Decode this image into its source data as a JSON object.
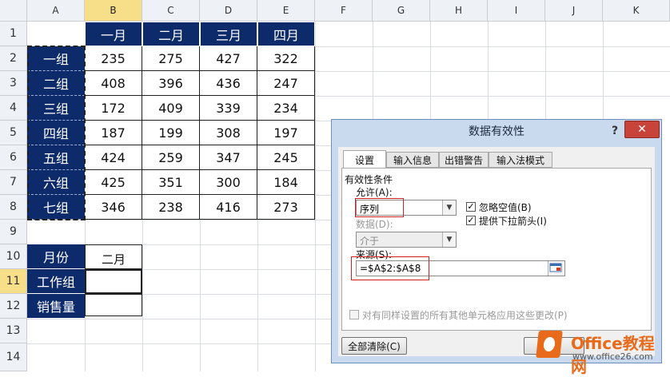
{
  "sheet": {
    "columns": [
      "A",
      "B",
      "C",
      "D",
      "E",
      "F",
      "G",
      "H",
      "I",
      "J",
      "K"
    ],
    "rows": [
      "1",
      "2",
      "3",
      "4",
      "5",
      "6",
      "7",
      "8",
      "9",
      "10",
      "11",
      "12",
      "13",
      "14"
    ],
    "table": {
      "headers": [
        "一月",
        "二月",
        "三月",
        "四月"
      ],
      "rows": [
        {
          "group": "一组",
          "values": [
            "235",
            "275",
            "427",
            "322"
          ]
        },
        {
          "group": "二组",
          "values": [
            "408",
            "396",
            "436",
            "247"
          ]
        },
        {
          "group": "三组",
          "values": [
            "172",
            "409",
            "339",
            "234"
          ]
        },
        {
          "group": "四组",
          "values": [
            "187",
            "199",
            "308",
            "197"
          ]
        },
        {
          "group": "五组",
          "values": [
            "424",
            "259",
            "347",
            "245"
          ]
        },
        {
          "group": "六组",
          "values": [
            "425",
            "351",
            "300",
            "184"
          ]
        },
        {
          "group": "七组",
          "values": [
            "346",
            "238",
            "416",
            "273"
          ]
        }
      ]
    },
    "lookup": {
      "month_label": "月份",
      "month_value": "二月",
      "group_label": "工作组",
      "group_value": "",
      "sales_label": "销售量",
      "sales_value": ""
    }
  },
  "dialog": {
    "title": "数据有效性",
    "help": "?",
    "close": "✕",
    "tabs": [
      "设置",
      "输入信息",
      "出错警告",
      "输入法模式"
    ],
    "section": "有效性条件",
    "allow_label": "允许(A):",
    "allow_value": "序列",
    "data_label": "数据(D):",
    "data_value": "介于",
    "ignore_blank": "忽略空值(B)",
    "dropdown": "提供下拉箭头(I)",
    "source_label": "来源(S):",
    "source_value": "=$A$2:$A$8",
    "apply_all": "对有同样设置的所有其他单元格应用这些更改(P)",
    "clear_all": "全部清除(C)",
    "check_mark": "✓",
    "arrow": "▼"
  },
  "watermark": {
    "brand": "Office教程网",
    "url": "www.office26.com"
  }
}
